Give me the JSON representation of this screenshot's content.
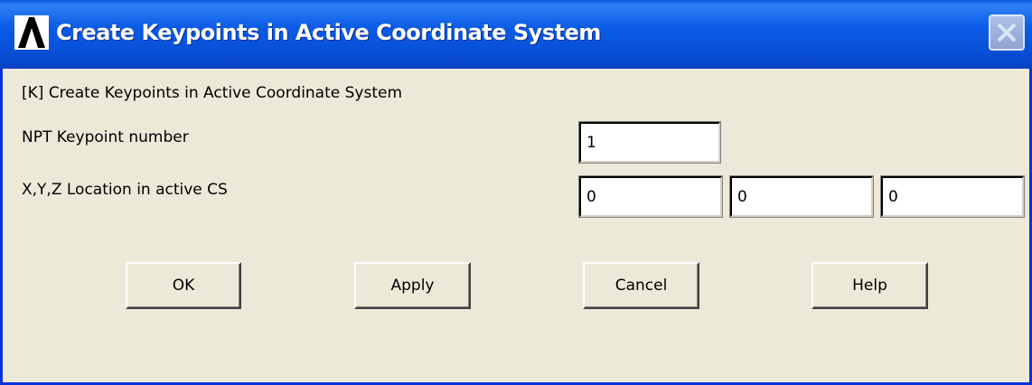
{
  "window": {
    "title": "Create Keypoints in Active Coordinate System",
    "app_icon": "ansys-logo-icon",
    "close_icon": "close-icon"
  },
  "form": {
    "heading": "[K]  Create Keypoints in Active Coordinate System",
    "npt_label": "NPT   Keypoint number",
    "npt_value": "1",
    "xyz_label": "X,Y,Z  Location in active CS",
    "x_value": "0",
    "y_value": "0",
    "z_value": "0"
  },
  "buttons": {
    "ok": "OK",
    "apply": "Apply",
    "cancel": "Cancel",
    "help": "Help"
  },
  "colors": {
    "titlebar": "#0b5be6",
    "dialog_bg": "#ece9d8"
  }
}
